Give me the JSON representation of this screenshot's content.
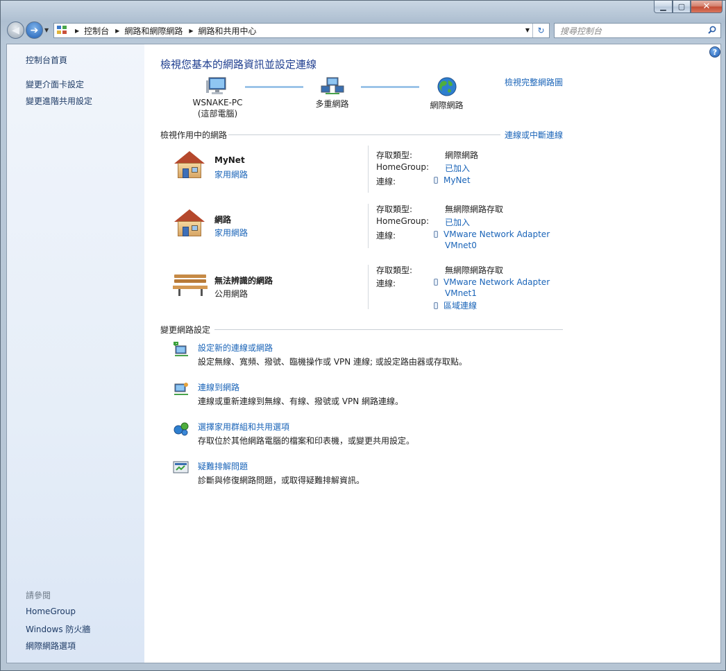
{
  "window": {
    "controls": {
      "minimize": "▁",
      "maximize": "▢",
      "close": "✕"
    }
  },
  "address_bar": {
    "breadcrumbs": [
      "控制台",
      "網路和網際網路",
      "網路和共用中心"
    ],
    "search_placeholder": "搜尋控制台"
  },
  "sidebar": {
    "items": [
      {
        "label": "控制台首頁"
      },
      {
        "label": "變更介面卡設定"
      },
      {
        "label": "變更進階共用設定"
      }
    ],
    "see_also_title": "請參閱",
    "see_also": [
      {
        "label": "HomeGroup"
      },
      {
        "label": "Windows 防火牆"
      },
      {
        "label": "網際網路選項"
      }
    ]
  },
  "main": {
    "title": "檢視您基本的網路資訊並設定連線",
    "full_map_link": "檢視完整網路圖",
    "map": {
      "pc_name": "WSNAKE-PC",
      "pc_sub": "(這部電腦)",
      "network": "多重網路",
      "internet": "網際網路"
    },
    "active_section": {
      "title": "檢視作用中的網路",
      "link": "連線或中斷連線"
    },
    "networks": [
      {
        "name": "MyNet",
        "category": "家用網路",
        "access_label": "存取類型:",
        "access": "網際網路",
        "homegroup_label": "HomeGroup:",
        "homegroup": "已加入",
        "conn_label": "連線:",
        "connection": "MyNet"
      },
      {
        "name": "網路",
        "category": "家用網路",
        "access_label": "存取類型:",
        "access": "無網際網路存取",
        "homegroup_label": "HomeGroup:",
        "homegroup": "已加入",
        "conn_label": "連線:",
        "connection": "VMware Network Adapter",
        "connection_2": "VMnet0"
      },
      {
        "name": "無法辨識的網路",
        "category": "公用網路",
        "access_label": "存取類型:",
        "access": "無網際網路存取",
        "conn_label": "連線:",
        "connection": "VMware Network Adapter",
        "connection_2": "VMnet1",
        "connection_b": "區域連線"
      }
    ],
    "change_section": {
      "title": "變更網路設定"
    },
    "tasks": [
      {
        "label": "設定新的連線或網路",
        "desc": "設定無線、寬頻、撥號、臨機操作或 VPN 連線; 或設定路由器或存取點。"
      },
      {
        "label": "連線到網路",
        "desc": "連線或重新連線到無線、有線、撥號或 VPN 網路連線。"
      },
      {
        "label": "選擇家用群組和共用選項",
        "desc": "存取位於其他網路電腦的檔案和印表機，或變更共用設定。"
      },
      {
        "label": "疑難排解問題",
        "desc": "診斷與修復網路問題，或取得疑難排解資訊。"
      }
    ]
  }
}
